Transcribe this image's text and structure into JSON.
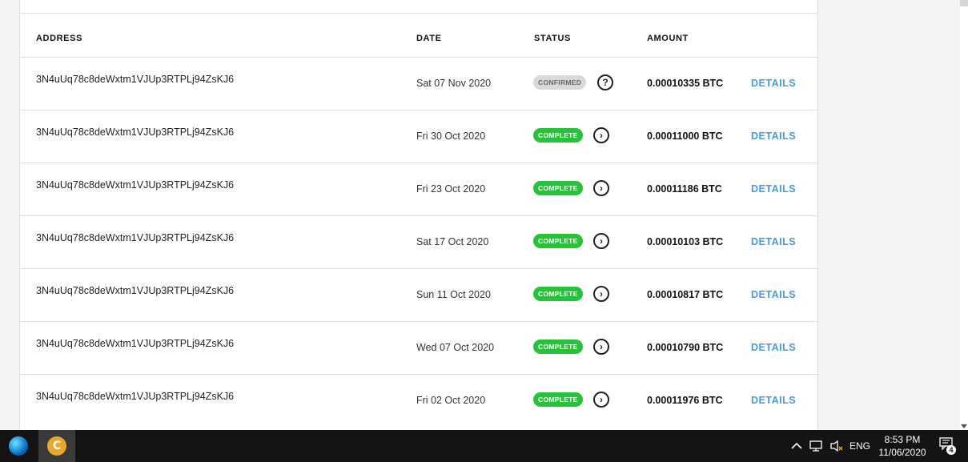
{
  "table": {
    "headers": {
      "address": "ADDRESS",
      "date": "DATE",
      "status": "STATUS",
      "amount": "AMOUNT"
    },
    "rows": [
      {
        "address": "3N4uUq78c8deWxtm1VJUp3RTPLj94ZsKJ6",
        "date": "Sat 07 Nov 2020",
        "status": "CONFIRMED",
        "status_kind": "confirmed",
        "status_icon": "help-icon",
        "amount": "0.00010335 BTC",
        "details": "DETAILS"
      },
      {
        "address": "3N4uUq78c8deWxtm1VJUp3RTPLj94ZsKJ6",
        "date": "Fri 30 Oct 2020",
        "status": "COMPLETE",
        "status_kind": "complete",
        "status_icon": "chevron-right-icon",
        "amount": "0.00011000 BTC",
        "details": "DETAILS"
      },
      {
        "address": "3N4uUq78c8deWxtm1VJUp3RTPLj94ZsKJ6",
        "date": "Fri 23 Oct 2020",
        "status": "COMPLETE",
        "status_kind": "complete",
        "status_icon": "chevron-right-icon",
        "amount": "0.00011186 BTC",
        "details": "DETAILS"
      },
      {
        "address": "3N4uUq78c8deWxtm1VJUp3RTPLj94ZsKJ6",
        "date": "Sat 17 Oct 2020",
        "status": "COMPLETE",
        "status_kind": "complete",
        "status_icon": "chevron-right-icon",
        "amount": "0.00010103 BTC",
        "details": "DETAILS"
      },
      {
        "address": "3N4uUq78c8deWxtm1VJUp3RTPLj94ZsKJ6",
        "date": "Sun 11 Oct 2020",
        "status": "COMPLETE",
        "status_kind": "complete",
        "status_icon": "chevron-right-icon",
        "amount": "0.00010817 BTC",
        "details": "DETAILS"
      },
      {
        "address": "3N4uUq78c8deWxtm1VJUp3RTPLj94ZsKJ6",
        "date": "Wed 07 Oct 2020",
        "status": "COMPLETE",
        "status_kind": "complete",
        "status_icon": "chevron-right-icon",
        "amount": "0.00010790 BTC",
        "details": "DETAILS"
      },
      {
        "address": "3N4uUq78c8deWxtm1VJUp3RTPLj94ZsKJ6",
        "date": "Fri 02 Oct 2020",
        "status": "COMPLETE",
        "status_kind": "complete",
        "status_icon": "chevron-right-icon",
        "amount": "0.00011976 BTC",
        "details": "DETAILS"
      }
    ]
  },
  "colors": {
    "complete_badge": "#27c13a",
    "confirmed_badge": "#d9d9d9",
    "details_link": "#4a9ad4"
  },
  "taskbar": {
    "apps": [
      "edge-icon",
      "coin-app-icon"
    ],
    "language": "ENG",
    "time": "8:53 PM",
    "date": "11/06/2020",
    "notification_count": "4"
  }
}
